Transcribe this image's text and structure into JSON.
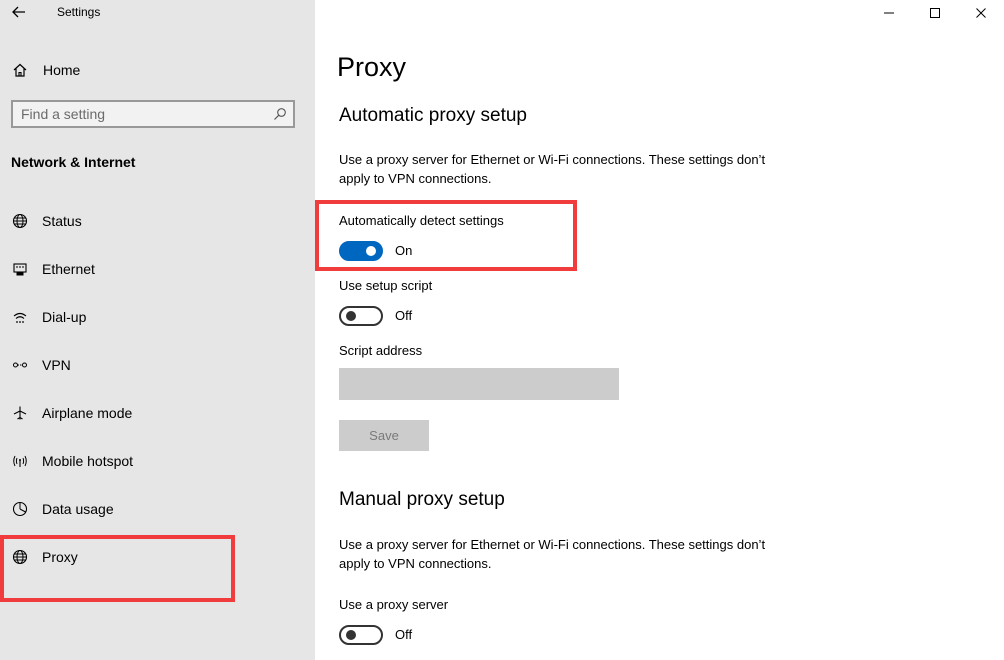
{
  "window": {
    "app_title": "Settings",
    "controls": [
      "minimize",
      "maximize",
      "close"
    ]
  },
  "sidebar": {
    "home_label": "Home",
    "search_placeholder": "Find a setting",
    "section_heading": "Network & Internet",
    "items": [
      {
        "label": "Status",
        "icon": "globe-icon"
      },
      {
        "label": "Ethernet",
        "icon": "ethernet-icon"
      },
      {
        "label": "Dial-up",
        "icon": "dialup-icon"
      },
      {
        "label": "VPN",
        "icon": "vpn-icon"
      },
      {
        "label": "Airplane mode",
        "icon": "airplane-icon"
      },
      {
        "label": "Mobile hotspot",
        "icon": "hotspot-icon"
      },
      {
        "label": "Data usage",
        "icon": "data-usage-icon"
      },
      {
        "label": "Proxy",
        "icon": "globe-icon",
        "selected": true
      }
    ]
  },
  "main": {
    "title": "Proxy",
    "auto": {
      "heading": "Automatic proxy setup",
      "description": "Use a proxy server for Ethernet or Wi-Fi connections. These settings don’t apply to VPN connections.",
      "detect": {
        "label": "Automatically detect settings",
        "state": "On",
        "on": true
      },
      "script": {
        "label": "Use setup script",
        "state": "Off",
        "on": false
      },
      "script_address_label": "Script address",
      "script_address_value": "",
      "save_label": "Save"
    },
    "manual": {
      "heading": "Manual proxy setup",
      "description": "Use a proxy server for Ethernet or Wi-Fi connections. These settings don’t apply to VPN connections.",
      "use_proxy": {
        "label": "Use a proxy server",
        "state": "Off",
        "on": false
      }
    }
  },
  "colors": {
    "sidebar_bg": "#e6e6e6",
    "accent": "#0067c0",
    "highlight": "#f03c3c",
    "disabled_bg": "#cccccc"
  }
}
